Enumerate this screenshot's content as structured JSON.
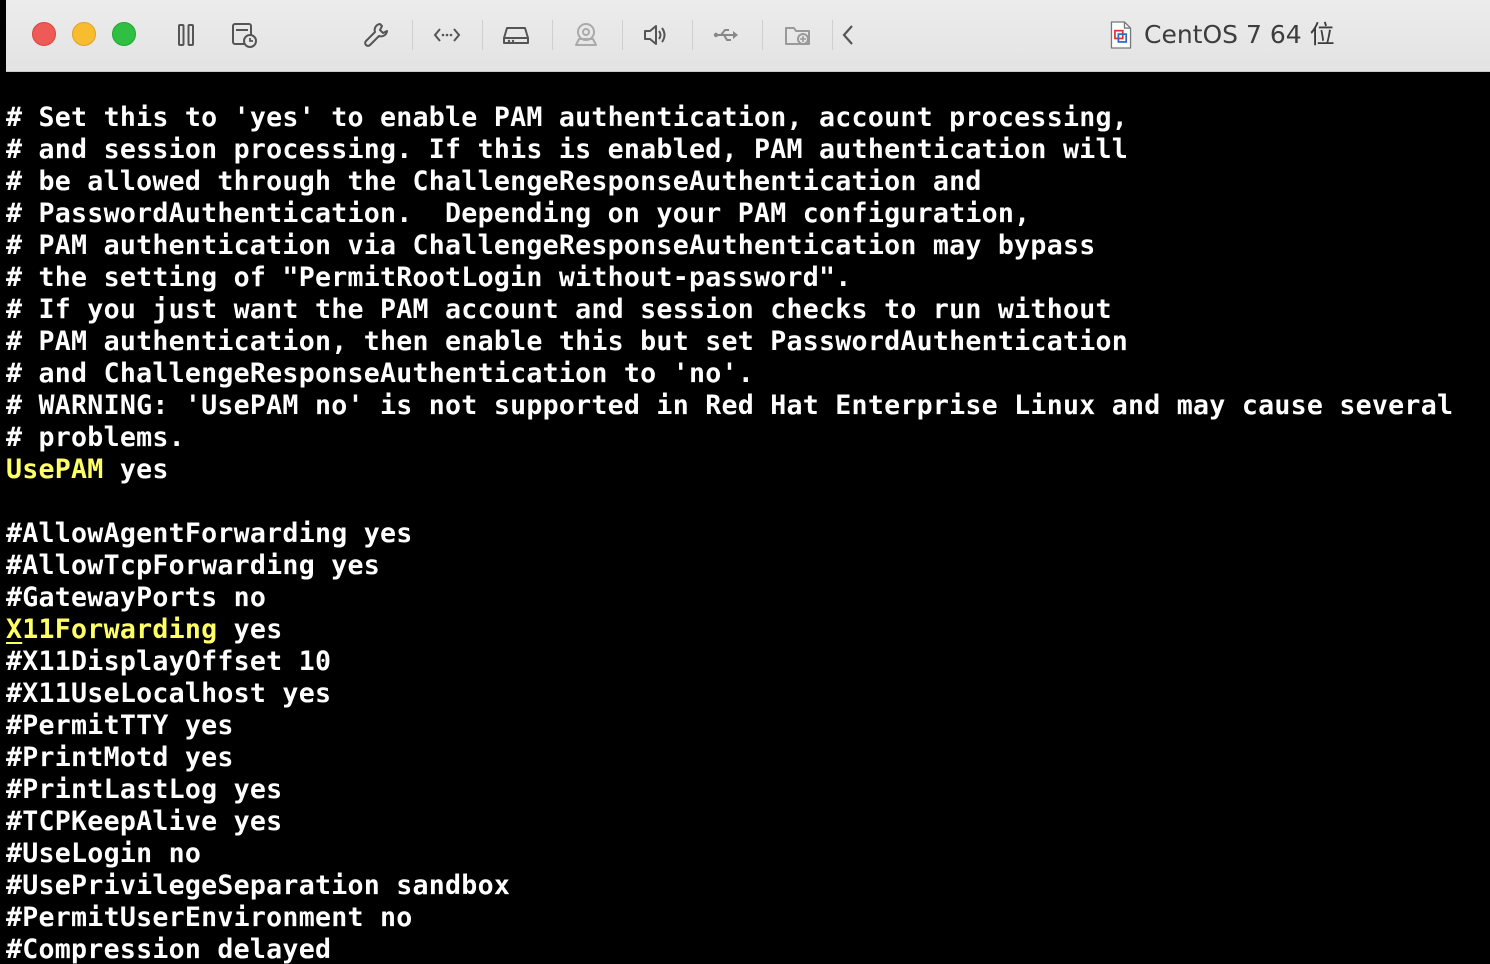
{
  "window": {
    "title": "CentOS 7 64 位"
  },
  "toolbar": {
    "icons": [
      "pause-icon",
      "snapshot-icon",
      "settings-wrench-icon",
      "network-code-icon",
      "hard-disk-icon",
      "camera-icon",
      "speaker-icon",
      "usb-icon",
      "shared-folder-icon",
      "collapse-chevron-icon"
    ]
  },
  "terminal": {
    "colors": {
      "background": "#000000",
      "text": "#ffffff",
      "keyword": "#ffff66"
    },
    "comment_lines": [
      "# Set this to 'yes' to enable PAM authentication, account processing,",
      "# and session processing. If this is enabled, PAM authentication will",
      "# be allowed through the ChallengeResponseAuthentication and",
      "# PasswordAuthentication.  Depending on your PAM configuration,",
      "# PAM authentication via ChallengeResponseAuthentication may bypass",
      "# the setting of \"PermitRootLogin without-password\".",
      "# If you just want the PAM account and session checks to run without",
      "# PAM authentication, then enable this but set PasswordAuthentication",
      "# and ChallengeResponseAuthentication to 'no'.",
      "# WARNING: 'UsePAM no' is not supported in Red Hat Enterprise Linux and may cause several",
      "# problems."
    ],
    "usepam": {
      "key": "UsePAM",
      "value": " yes"
    },
    "allow_agent": "#AllowAgentForwarding yes",
    "allow_tcp": "#AllowTcpForwarding yes",
    "gateway_ports": "#GatewayPorts no",
    "x11forwarding": {
      "cursor_char": "X",
      "key_rest": "11Forwarding",
      "value": " yes"
    },
    "settings_lines": [
      "#X11DisplayOffset 10",
      "#X11UseLocalhost yes",
      "#PermitTTY yes",
      "#PrintMotd yes",
      "#PrintLastLog yes",
      "#TCPKeepAlive yes",
      "#UseLogin no",
      "#UsePrivilegeSeparation sandbox",
      "#PermitUserEnvironment no",
      "#Compression delayed"
    ]
  }
}
